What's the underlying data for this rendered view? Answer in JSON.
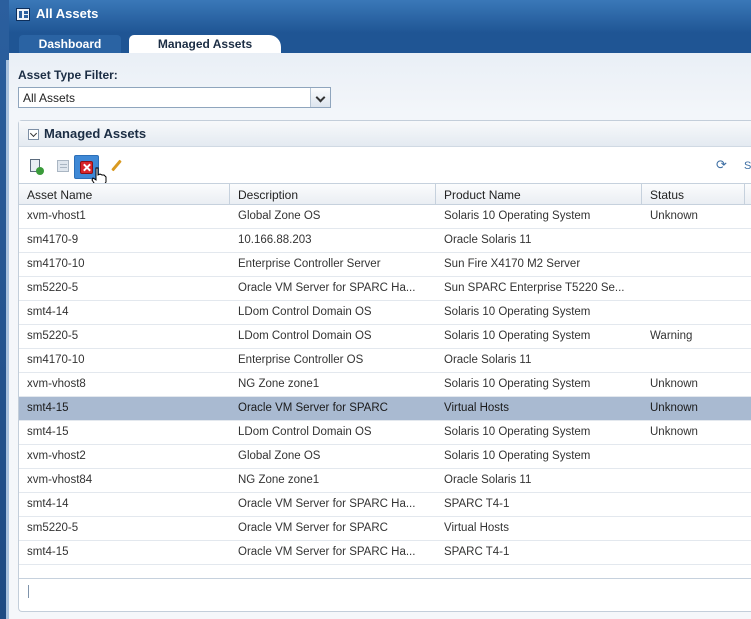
{
  "window": {
    "title": "All Assets",
    "icon": "grid-window-icon"
  },
  "tabs": [
    {
      "label": "Dashboard",
      "active": false
    },
    {
      "label": "Managed Assets",
      "active": true
    }
  ],
  "filter": {
    "label": "Asset Type Filter:",
    "selected": "All Assets"
  },
  "panel": {
    "title": "Managed Assets"
  },
  "toolbar": {
    "icons": [
      "add-asset-icon",
      "edit-list-icon",
      "delete-icon",
      "edit-pencil-icon",
      "refresh-icon"
    ],
    "more_label": "S"
  },
  "table": {
    "columns": [
      "Asset Name",
      "Description",
      "Product Name",
      "Status"
    ],
    "rows": [
      [
        "xvm-vhost1",
        "Global Zone OS",
        "Solaris 10 Operating System",
        "Unknown"
      ],
      [
        "sm4170-9",
        "10.166.88.203",
        "Oracle Solaris 11",
        ""
      ],
      [
        "sm4170-10",
        "Enterprise Controller Server",
        "Sun Fire X4170 M2 Server",
        ""
      ],
      [
        "sm5220-5",
        "Oracle VM Server for SPARC Ha...",
        "Sun SPARC Enterprise T5220 Se...",
        ""
      ],
      [
        "smt4-14",
        "LDom Control Domain OS",
        "Solaris 10 Operating System",
        ""
      ],
      [
        "sm5220-5",
        "LDom Control Domain OS",
        "Solaris 10 Operating System",
        "Warning"
      ],
      [
        "sm4170-10",
        "Enterprise Controller OS",
        "Oracle Solaris 11",
        ""
      ],
      [
        "xvm-vhost8",
        "NG Zone zone1",
        "Solaris 10 Operating System",
        "Unknown"
      ],
      [
        "smt4-15",
        "Oracle VM Server for SPARC",
        "Virtual Hosts",
        "Unknown"
      ],
      [
        "smt4-15",
        "LDom Control Domain OS",
        "Solaris 10 Operating System",
        "Unknown"
      ],
      [
        "xvm-vhost2",
        "Global Zone OS",
        "Solaris 10 Operating System",
        ""
      ],
      [
        "xvm-vhost84",
        "NG Zone zone1",
        "Oracle Solaris 11",
        ""
      ],
      [
        "smt4-14",
        "Oracle VM Server for SPARC Ha...",
        "SPARC T4-1",
        ""
      ],
      [
        "sm5220-5",
        "Oracle VM Server for SPARC",
        "Virtual Hosts",
        ""
      ],
      [
        "smt4-15",
        "Oracle VM Server for SPARC Ha...",
        "SPARC T4-1",
        ""
      ]
    ],
    "selected_row": 8
  }
}
